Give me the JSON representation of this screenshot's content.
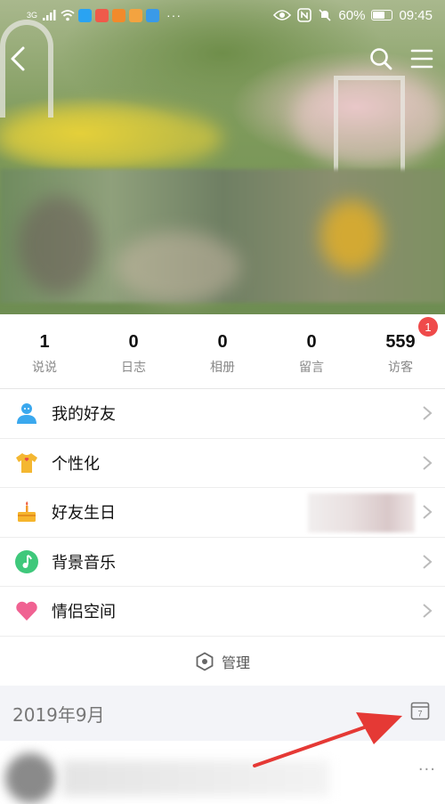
{
  "status_bar": {
    "network": "3G",
    "battery": "60%",
    "time": "09:45",
    "icons": [
      "signal-icon",
      "wifi-icon",
      "eye-icon",
      "nfc-icon",
      "mute-icon",
      "battery-icon"
    ],
    "more": "···"
  },
  "nav": {
    "icons": [
      "back-icon",
      "search-icon",
      "menu-icon"
    ]
  },
  "stats": [
    {
      "value": "1",
      "label": "说说"
    },
    {
      "value": "0",
      "label": "日志"
    },
    {
      "value": "0",
      "label": "相册"
    },
    {
      "value": "0",
      "label": "留言"
    },
    {
      "value": "559",
      "label": "访客",
      "badge": "1"
    }
  ],
  "menu": [
    {
      "label": "我的好友",
      "icon": "friends-icon"
    },
    {
      "label": "个性化",
      "icon": "tshirt-icon"
    },
    {
      "label": "好友生日",
      "icon": "birthday-cake-icon"
    },
    {
      "label": "背景音乐",
      "icon": "music-note-icon"
    },
    {
      "label": "情侣空间",
      "icon": "heart-icon"
    }
  ],
  "manage": {
    "label": "管理",
    "icon": "hexagon-icon"
  },
  "date_section": {
    "label": "2019年9月",
    "calendar_day": "7"
  },
  "feed": {
    "more": "···"
  },
  "colors": {
    "badge": "#ef4a4a",
    "friends_icon": "#3aa8ee",
    "music_icon": "#3fc87b",
    "heart_icon": "#f06292",
    "annotation_arrow": "#e53935",
    "date_bar_bg": "#f3f4f8"
  }
}
